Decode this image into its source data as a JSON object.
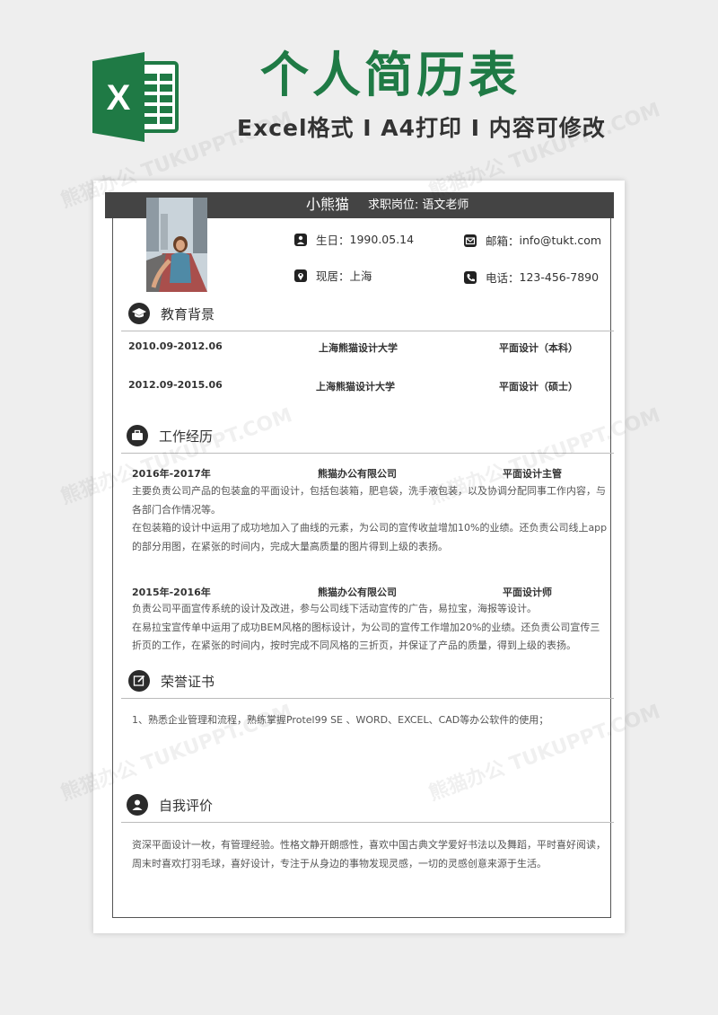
{
  "banner": {
    "title": "个人简历表",
    "subtitle": "Excel格式 I A4打印 I 内容可修改",
    "logo_letter": "X"
  },
  "watermark": "熊猫办公 TUKUPPT.COM",
  "header": {
    "name": "小熊猫",
    "job_label": "求职岗位:",
    "job_value": "语文老师"
  },
  "info": {
    "birth_label": "生日：",
    "birth_value": "1990.05.14",
    "email_label": "邮箱：",
    "email_value": "info@tukt.com",
    "residence_label": "现居：",
    "residence_value": "上海",
    "phone_label": "电话：",
    "phone_value": "123-456-7890"
  },
  "education": {
    "title": "教育背景",
    "rows": [
      {
        "period": "2010.09-2012.06",
        "school": "上海熊猫设计大学",
        "major": "平面设计（本科）"
      },
      {
        "period": "2012.09-2015.06",
        "school": "上海熊猫设计大学",
        "major": "平面设计（硕士）"
      }
    ]
  },
  "work": {
    "title": "工作经历",
    "jobs": [
      {
        "period": "2016年-2017年",
        "company": "熊猫办公有限公司",
        "position": "平面设计主管",
        "lines": [
          "主要负责公司产品的包装盒的平面设计，包括包装箱，肥皂袋，洗手液包装，以及协调分配同事工作内容，与各部门合作情况等。",
          "在包装箱的设计中运用了成功地加入了曲线的元素，为公司的宣传收益增加10%的业绩。还负责公司线上app的部分用图，在紧张的时间内，完成大量高质量的图片得到上级的表扬。"
        ]
      },
      {
        "period": "2015年-2016年",
        "company": "熊猫办公有限公司",
        "position": "平面设计师",
        "lines": [
          "负责公司平面宣传系统的设计及改进，参与公司线下活动宣传的广告，易拉宝，海报等设计。",
          "在易拉宝宣传单中运用了成功BEM风格的图标设计，为公司的宣传工作增加20%的业绩。还负责公司宣传三折页的工作，在紧张的时间内，按时完成不同风格的三折页，并保证了产品的质量，得到上级的表扬。"
        ]
      }
    ]
  },
  "honors": {
    "title": "荣誉证书",
    "text": "1、熟悉企业管理和流程，熟练掌握Protel99 SE 、WORD、EXCEL、CAD等办公软件的使用；"
  },
  "self_eval": {
    "title": "自我评价",
    "text": "资深平面设计一枚，有管理经验。性格文静开朗感性，喜欢中国古典文学爱好书法以及舞蹈，平时喜好阅读，周末时喜欢打羽毛球，喜好设计，专注于从身边的事物发现灵感，一切的灵感创意来源于生活。"
  },
  "colors": {
    "brand_green": "#1f7a45",
    "header_bar": "#444444"
  }
}
